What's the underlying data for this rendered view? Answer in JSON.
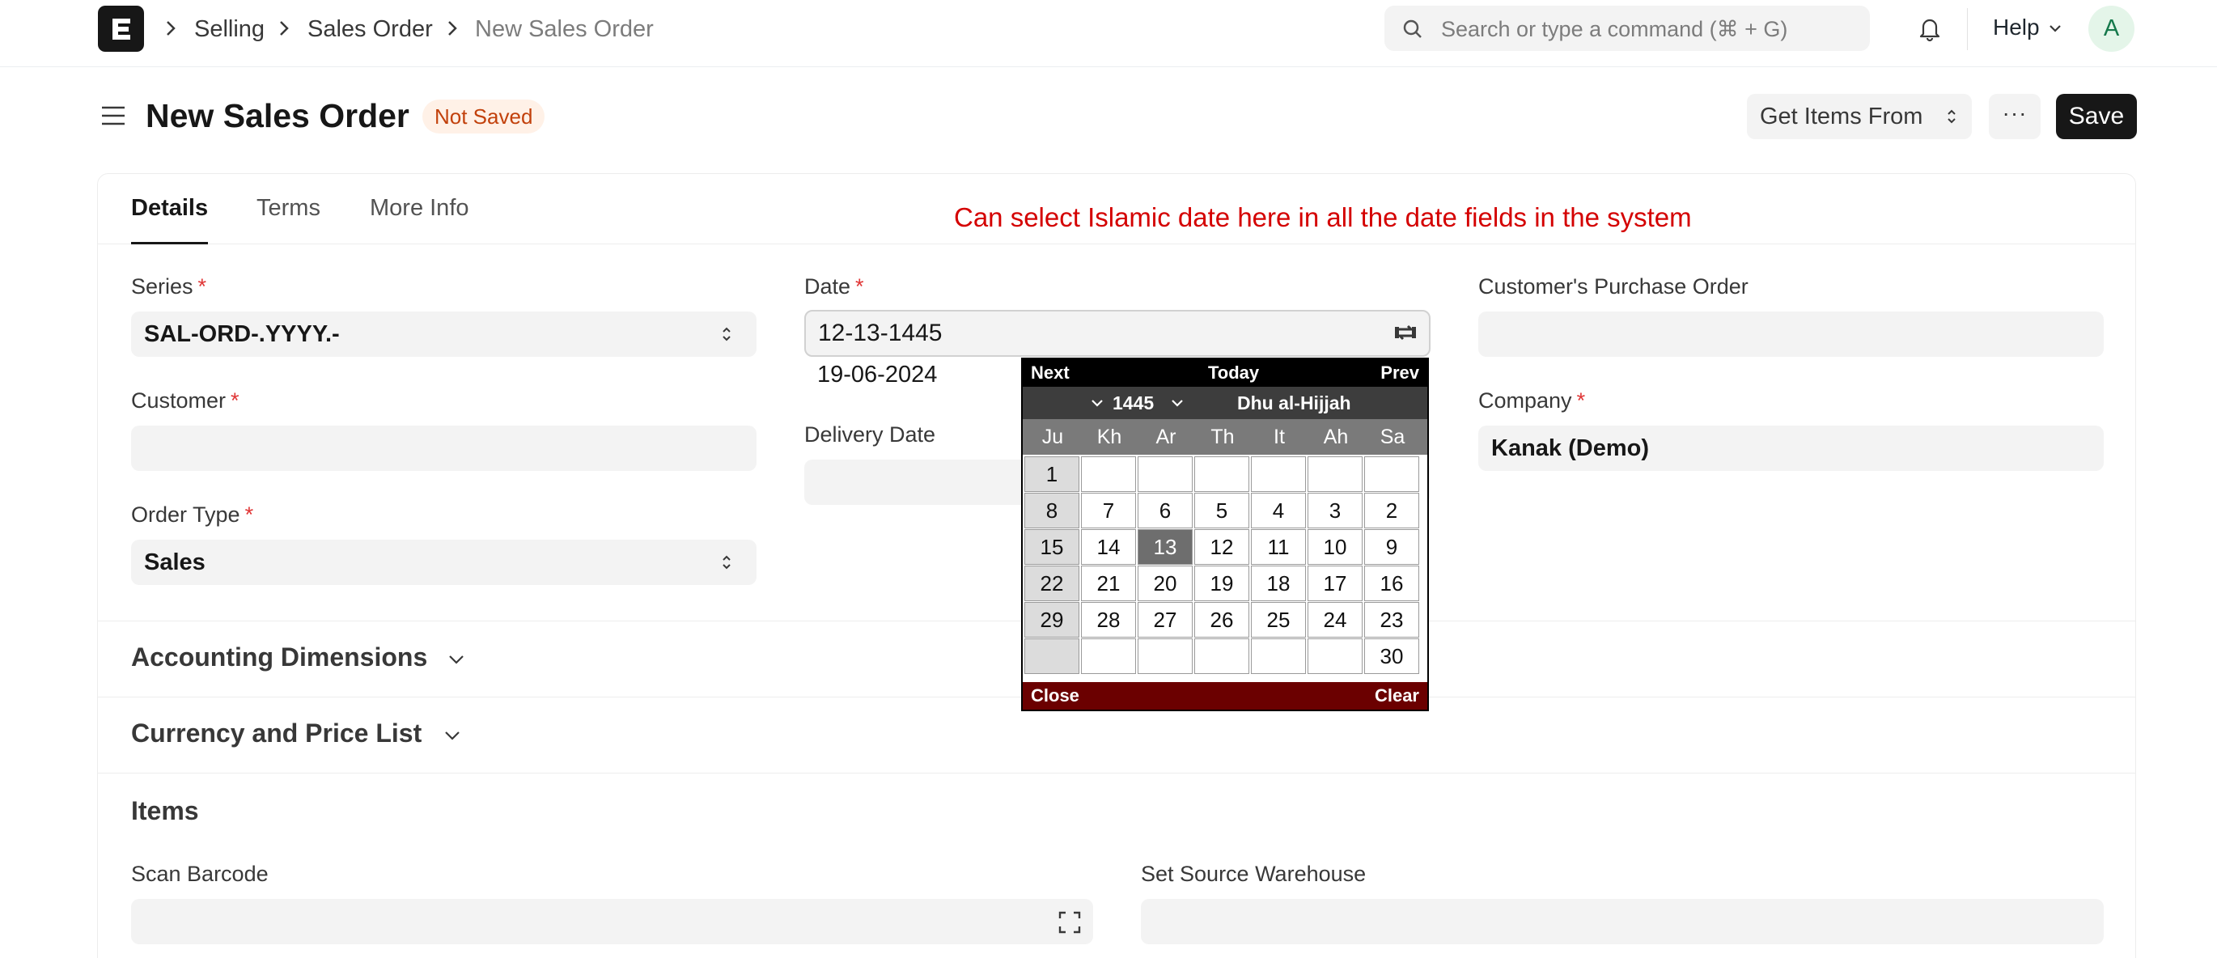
{
  "nav": {
    "breadcrumbs": [
      "Selling",
      "Sales Order",
      "New Sales Order"
    ],
    "search_placeholder": "Search or type a command (⌘ + G)",
    "help_label": "Help",
    "avatar_initial": "A"
  },
  "header": {
    "title": "New Sales Order",
    "status": "Not Saved",
    "get_items_label": "Get Items From",
    "more_label": "···",
    "save_label": "Save"
  },
  "tabs": [
    "Details",
    "Terms",
    "More Info"
  ],
  "annotation": "Can select Islamic date here in all the date fields in the system",
  "fields": {
    "series": {
      "label": "Series",
      "value": "SAL-ORD-.YYYY.-"
    },
    "customer": {
      "label": "Customer",
      "value": ""
    },
    "order_type": {
      "label": "Order Type",
      "value": "Sales"
    },
    "date": {
      "label": "Date",
      "value": "12-13-1445",
      "gregorian": "19-06-2024"
    },
    "delivery_date": {
      "label": "Delivery Date",
      "value": ""
    },
    "customer_po": {
      "label": "Customer's Purchase Order",
      "value": ""
    },
    "company": {
      "label": "Company",
      "value": "Kanak (Demo)"
    },
    "required_mark": "*"
  },
  "sections": {
    "accounting": "Accounting Dimensions",
    "currency": "Currency and Price List",
    "items": "Items",
    "scan_barcode": "Scan Barcode",
    "source_warehouse": "Set Source Warehouse"
  },
  "hijri_calendar": {
    "next_label": "Next",
    "today_label": "Today",
    "prev_label": "Prev",
    "year": "1445",
    "month": "Dhu al-Hijjah",
    "weekdays": [
      "Ju",
      "Kh",
      "Ar",
      "Th",
      "It",
      "Ah",
      "Sa"
    ],
    "weeks": [
      [
        "1",
        "",
        "",
        "",
        "",
        "",
        ""
      ],
      [
        "8",
        "7",
        "6",
        "5",
        "4",
        "3",
        "2"
      ],
      [
        "15",
        "14",
        "13",
        "12",
        "11",
        "10",
        "9"
      ],
      [
        "22",
        "21",
        "20",
        "19",
        "18",
        "17",
        "16"
      ],
      [
        "29",
        "28",
        "27",
        "26",
        "25",
        "24",
        "23"
      ],
      [
        "",
        "",
        "",
        "",
        "",
        "",
        "30"
      ]
    ],
    "selected_day": "13",
    "close_label": "Close",
    "clear_label": "Clear"
  },
  "colors": {
    "primary_button": "#171717",
    "annotation": "#d40000",
    "badge_text": "#c2410c",
    "badge_bg": "#fff1e7",
    "calendar_footer": "#6b0000"
  },
  "icons": [
    "app-logo",
    "chevron-right-icon",
    "search-icon",
    "bell-icon",
    "chevron-down-icon",
    "hamburger-icon",
    "select-updown-icon",
    "calendar-switch-icon",
    "scan-barcode-icon"
  ]
}
